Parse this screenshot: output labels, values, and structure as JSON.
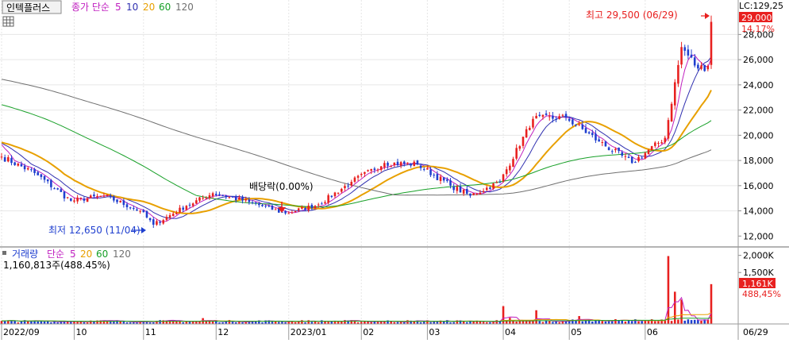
{
  "header": {
    "stock_name": "인텍플러스",
    "ma_label": "종가 단순",
    "ma_periods": [
      "5",
      "10",
      "20",
      "60",
      "120"
    ],
    "lc_value": "LC:129,25",
    "price_badge": "29,000",
    "change_badge": "14,17%",
    "high_annotation": "최고 29,500 (06/29)",
    "low_annotation": "최저 12,650 (11/04)",
    "dividend_annotation": "배당락(0.00%)"
  },
  "volume_header": {
    "label": "거래량",
    "ma_label": "단순",
    "ma_periods": [
      "5",
      "20",
      "60",
      "120"
    ],
    "current": "1,160,813주(488.45%)",
    "badge_value": "1,161K",
    "badge_pct": "488,45%"
  },
  "colors": {
    "up": "#e8201f",
    "down": "#1f3fcf",
    "ma5": "#c020c0",
    "ma10": "#3030b0",
    "ma20": "#e8a000",
    "ma60": "#18a028",
    "ma120": "#707070"
  },
  "chart_data": [
    {
      "type": "candlestick",
      "title": "인텍플러스",
      "y_ticks": [
        "12,000",
        "14,000",
        "16,000",
        "18,000",
        "20,000",
        "22,000",
        "24,000",
        "26,000",
        "28,000"
      ],
      "ylim": [
        11200,
        29600
      ],
      "x_ticks": [
        "2022/09",
        "10",
        "11",
        "12",
        "2023/01",
        "02",
        "03",
        "04",
        "05",
        "06",
        "06/29"
      ],
      "period": "2022/09 – 2023/06/29 (daily)",
      "high": {
        "value": 29500,
        "date": "06/29"
      },
      "low": {
        "value": 12650,
        "date": "11/04"
      },
      "last": {
        "close": 29000,
        "change_pct": 14.17
      },
      "series": [
        {
          "name": "5",
          "type": "sma",
          "period": 5
        },
        {
          "name": "10",
          "type": "sma",
          "period": 10
        },
        {
          "name": "20",
          "type": "sma",
          "period": 20
        },
        {
          "name": "60",
          "type": "sma",
          "period": 60
        },
        {
          "name": "120",
          "type": "sma",
          "period": 120
        }
      ],
      "anchor_closes": [
        [
          "2022-09-01",
          18300
        ],
        [
          "2022-09-15",
          17000
        ],
        [
          "2022-09-30",
          14800
        ],
        [
          "2022-10-14",
          15200
        ],
        [
          "2022-10-31",
          14000
        ],
        [
          "2022-11-04",
          12900
        ],
        [
          "2022-11-18",
          14400
        ],
        [
          "2022-11-30",
          15400
        ],
        [
          "2022-12-15",
          14700
        ],
        [
          "2022-12-30",
          13800
        ],
        [
          "2023-01-13",
          14500
        ],
        [
          "2023-01-27",
          16300
        ],
        [
          "2023-02-10",
          17800
        ],
        [
          "2023-02-24",
          17700
        ],
        [
          "2023-03-10",
          16000
        ],
        [
          "2023-03-20",
          15200
        ],
        [
          "2023-03-31",
          16300
        ],
        [
          "2023-04-14",
          21300
        ],
        [
          "2023-04-28",
          21400
        ],
        [
          "2023-05-12",
          19500
        ],
        [
          "2023-05-26",
          17800
        ],
        [
          "2023-06-09",
          19800
        ],
        [
          "2023-06-16",
          27000
        ],
        [
          "2023-06-23",
          25300
        ],
        [
          "2023-06-28",
          25500
        ],
        [
          "2023-06-29",
          29000
        ]
      ]
    },
    {
      "type": "bar",
      "title": "거래량",
      "y_ticks": [
        "2,000K",
        "1,500K"
      ],
      "ylim": [
        0,
        2200
      ],
      "unit": "K shares",
      "last": {
        "value_k": 1161,
        "ratio_pct": 488.45
      },
      "spikes_k": [
        [
          "2022-11-25",
          170
        ],
        [
          "2023-04-03",
          520
        ],
        [
          "2023-04-05",
          180
        ],
        [
          "2023-04-17",
          400
        ],
        [
          "2023-05-04",
          230
        ],
        [
          "2023-06-12",
          1980
        ],
        [
          "2023-06-14",
          940
        ],
        [
          "2023-06-16",
          710
        ],
        [
          "2023-06-29",
          1161
        ]
      ]
    }
  ]
}
